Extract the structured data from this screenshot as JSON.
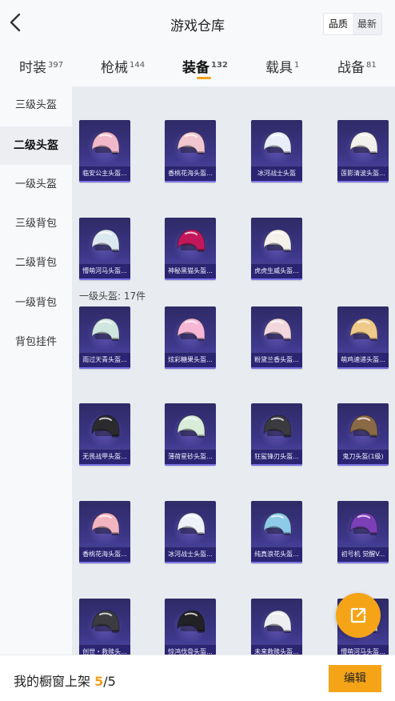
{
  "header": {
    "title": "游戏仓库",
    "sort_options": [
      "品质",
      "最新"
    ]
  },
  "tabs": [
    {
      "label": "时装",
      "count": "397"
    },
    {
      "label": "枪械",
      "count": "144"
    },
    {
      "label": "装备",
      "count": "132",
      "active": true
    },
    {
      "label": "载具",
      "count": "1"
    },
    {
      "label": "战备",
      "count": "81"
    }
  ],
  "sidebar": {
    "items": [
      "三级头盔",
      "二级头盔",
      "一级头盔",
      "三级背包",
      "二级背包",
      "一级背包",
      "背包挂件"
    ],
    "active_index": 1
  },
  "section_label": "一级头盔: 17件",
  "level2_items": [
    {
      "name": "临安公主头盔...",
      "icon": "helmet-pink-floral-icon",
      "color": "#f0b8c8"
    },
    {
      "name": "香桃花海头盔...",
      "icon": "helmet-pink-icon",
      "color": "#f1c6cf"
    },
    {
      "name": "冰河战士头盔",
      "icon": "helmet-blue-white-icon",
      "color": "#e8eef8"
    },
    {
      "name": "莲影清波头盔...",
      "icon": "helmet-white-icon",
      "color": "#f2f0ec"
    },
    {
      "name": "懵萌河马头盔...",
      "icon": "helmet-hippo-icon",
      "color": "#dce8f0"
    },
    {
      "name": "神秘黑猫头盔...",
      "icon": "helmet-cat-icon",
      "color": "#c2185b"
    },
    {
      "name": "虎虎生威头盔...",
      "icon": "helmet-tiger-icon",
      "color": "#f4f0ea"
    }
  ],
  "level1_items": [
    {
      "name": "雨过天青头盔...",
      "icon": "helmet-mint-icon",
      "color": "#cfe6df"
    },
    {
      "name": "炫彩糖果头盔...",
      "icon": "helmet-candy-icon",
      "color": "#f6b7d6"
    },
    {
      "name": "粉黛兰香头盔...",
      "icon": "helmet-rose-icon",
      "color": "#f2d7dd"
    },
    {
      "name": "萌鸡速递头盔...",
      "icon": "helmet-chick-icon",
      "color": "#efc98a"
    },
    {
      "name": "无畏战甲头盔...",
      "icon": "helmet-dark-gold-icon",
      "color": "#2b2b2e"
    },
    {
      "name": "薄荷星砂头盔...",
      "icon": "helmet-mint-green-icon",
      "color": "#d8ecd8"
    },
    {
      "name": "狂鲨锋刃头盔...",
      "icon": "helmet-shark-icon",
      "color": "#3a3a3f"
    },
    {
      "name": "鬼刀头盔(1级)",
      "icon": "helmet-samurai-icon",
      "color": "#8a6a45"
    },
    {
      "name": "香桃花海头盔...",
      "icon": "helmet-peach-icon",
      "color": "#f2b5bf"
    },
    {
      "name": "冰河战士头盔...",
      "icon": "helmet-racing-blue-icon",
      "color": "#eef2f8"
    },
    {
      "name": "纯真浪花头盔...",
      "icon": "helmet-wave-icon",
      "color": "#8ecbe8"
    },
    {
      "name": "初号机 觉醒V...",
      "icon": "helmet-purple-icon",
      "color": "#7b3fb8"
    },
    {
      "name": "创世・救赎头...",
      "icon": "helmet-grey-gold-icon",
      "color": "#3b3b40"
    },
    {
      "name": "惊鸿伐骨头盔...",
      "icon": "helmet-black-red-icon",
      "color": "#222226"
    },
    {
      "name": "未来救赎头盔...",
      "icon": "helmet-white-grey-icon",
      "color": "#eceef0"
    },
    {
      "name": "懵萌河马头盔...",
      "icon": "helmet-hippo-icon",
      "color": "#dce8f0"
    }
  ],
  "bottom": {
    "shelf_label": "我的橱窗上架",
    "shelf_current": "5",
    "shelf_total": "/5",
    "edit_label": "编辑"
  },
  "fab_icon": "share-external-icon",
  "accent_color": "#f5a418"
}
